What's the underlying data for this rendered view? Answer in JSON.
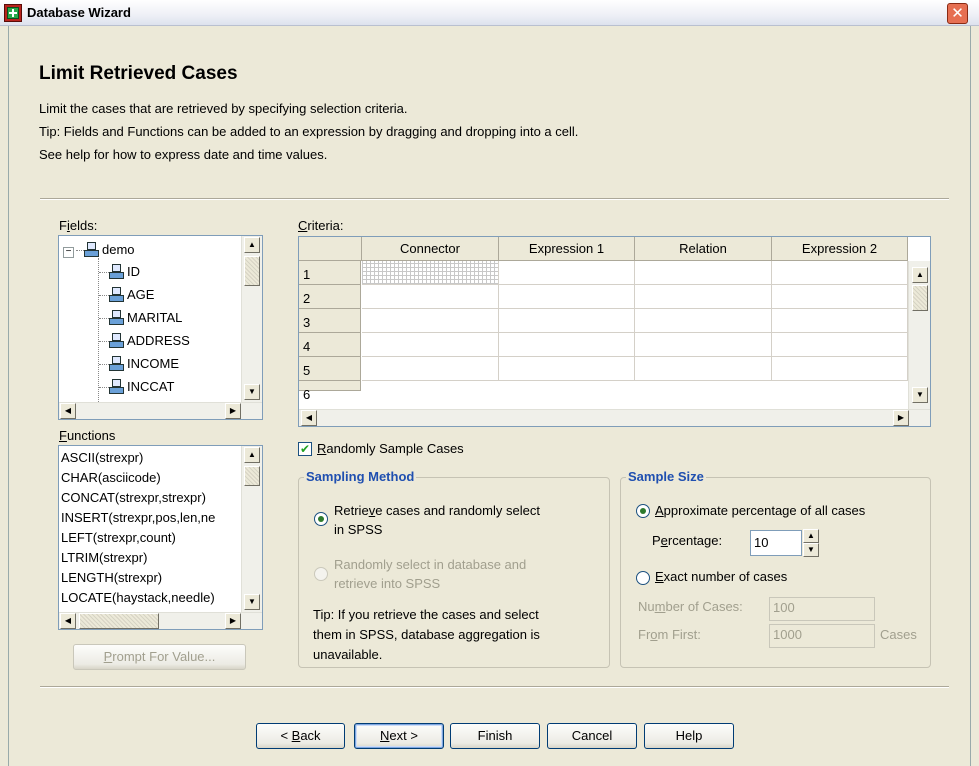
{
  "window": {
    "title": "Database Wizard",
    "close_glyph": "✕"
  },
  "header": {
    "heading": "Limit Retrieved Cases",
    "lines": [
      "Limit the cases that are retrieved by specifying selection criteria.",
      "Tip: Fields and Functions can be added to an expression by dragging and dropping into a cell.",
      "See help for how to express date and time values."
    ]
  },
  "fields": {
    "label_prefix": "F",
    "label_mnemonic": "i",
    "label_suffix": "elds:",
    "root": "demo",
    "items": [
      "ID",
      "AGE",
      "MARITAL",
      "ADDRESS",
      "INCOME",
      "INCCAT"
    ]
  },
  "functions": {
    "label_mnemonic": "F",
    "label_suffix": "unctions",
    "items": [
      "ASCII(strexpr)",
      "CHAR(asciicode)",
      "CONCAT(strexpr,strexpr)",
      "INSERT(strexpr,pos,len,ne",
      "LEFT(strexpr,count)",
      "LTRIM(strexpr)",
      "LENGTH(strexpr)",
      "LOCATE(haystack,needle)"
    ]
  },
  "prompt_button": {
    "mnemonic": "P",
    "rest": "rompt For Value..."
  },
  "criteria": {
    "label_mnemonic": "C",
    "label_suffix": "riteria:",
    "columns": [
      "Connector",
      "Expression 1",
      "Relation",
      "Expression 2"
    ],
    "rows": [
      "1",
      "2",
      "3",
      "4",
      "5",
      "6"
    ]
  },
  "random_sample": {
    "mnemonic": "R",
    "rest": "andomly Sample Cases",
    "checked": true,
    "check_glyph": "✔"
  },
  "sampling_method": {
    "title": "Sampling Method",
    "option1_line1_a": "Retrie",
    "option1_line1_m": "v",
    "option1_line1_b": "e cases and randomly select",
    "option1_line2": "in SPSS",
    "option2_line1": "Randomly select in database and",
    "option2_line2": "retrieve into SPSS",
    "tip_lines": [
      "Tip: If you retrieve the cases and select",
      "them in SPSS, database aggregation is",
      "unavailable."
    ]
  },
  "sample_size": {
    "title": "Sample Size",
    "opt1_mnemonic": "A",
    "opt1_rest": "pproximate percentage of all cases",
    "percentage_a": "P",
    "percentage_m": "e",
    "percentage_b": "rcentage:",
    "percentage_value": "10",
    "opt2_mnemonic": "E",
    "opt2_rest": "xact number of cases",
    "num_cases_a": "Nu",
    "num_cases_m": "m",
    "num_cases_b": "ber of Cases:",
    "num_cases_value": "100",
    "from_first_a": "Fr",
    "from_first_m": "o",
    "from_first_b": "m First:",
    "from_first_value": "1000",
    "cases_unit": "Cases"
  },
  "buttons": {
    "back_pre": "< ",
    "back_m": "B",
    "back_post": "ack",
    "next_m": "N",
    "next_post": "ext >",
    "finish": "Finish",
    "cancel": "Cancel",
    "help": "Help"
  }
}
